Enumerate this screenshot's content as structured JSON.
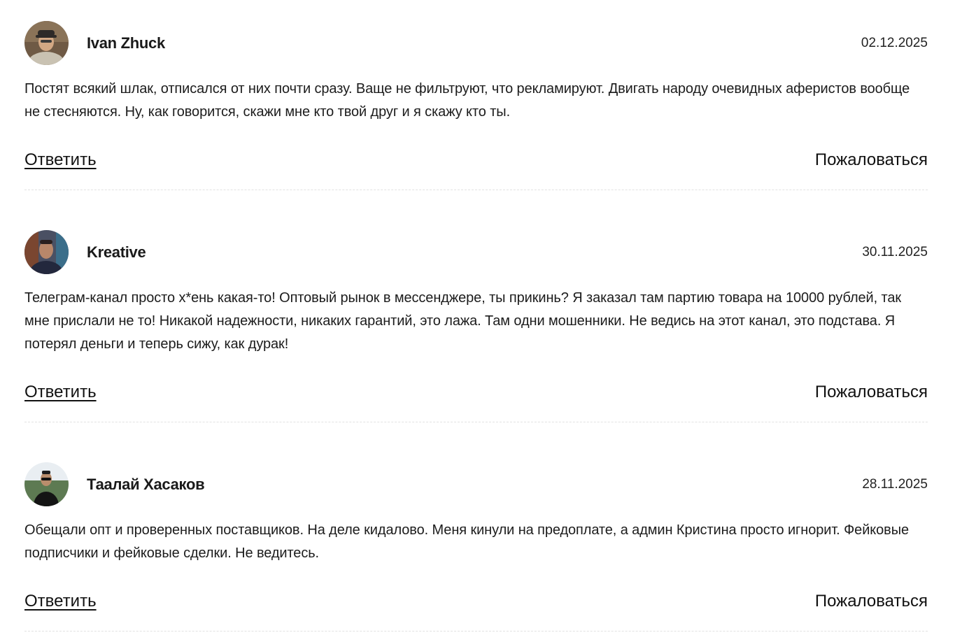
{
  "comments": [
    {
      "author": "Ivan Zhuck",
      "date": "02.12.2025",
      "text": "Постят всякий шлак, отписался от них почти сразу. Ваще не фильтруют, что рекламируют. Двигать народу очевидных аферистов вообще не стесняются. Ну, как говорится, скажи мне кто твой друг и я скажу кто ты.",
      "reply_label": "Ответить",
      "report_label": "Пожаловаться"
    },
    {
      "author": "Kreative",
      "date": "30.11.2025",
      "text": "Телеграм-канал просто х*ень какая-то! Оптовый рынок в мессенджере, ты прикинь? Я заказал там партию товара на 10000 рублей, так мне прислали не то! Никакой надежности, никаких гарантий, это лажа. Там одни мошенники. Не ведись на этот канал, это подстава. Я потерял деньги и теперь сижу, как дурак!",
      "reply_label": "Ответить",
      "report_label": "Пожаловаться"
    },
    {
      "author": "Таалай Хасаков",
      "date": "28.11.2025",
      "text": "Обещали опт и проверенных поставщиков. На деле кидалово. Меня кинули на предоплате, а админ Кристина просто игнорит. Фейковые подписчики и фейковые сделки. Не ведитесь.",
      "reply_label": "Ответить",
      "report_label": "Пожаловаться"
    }
  ]
}
